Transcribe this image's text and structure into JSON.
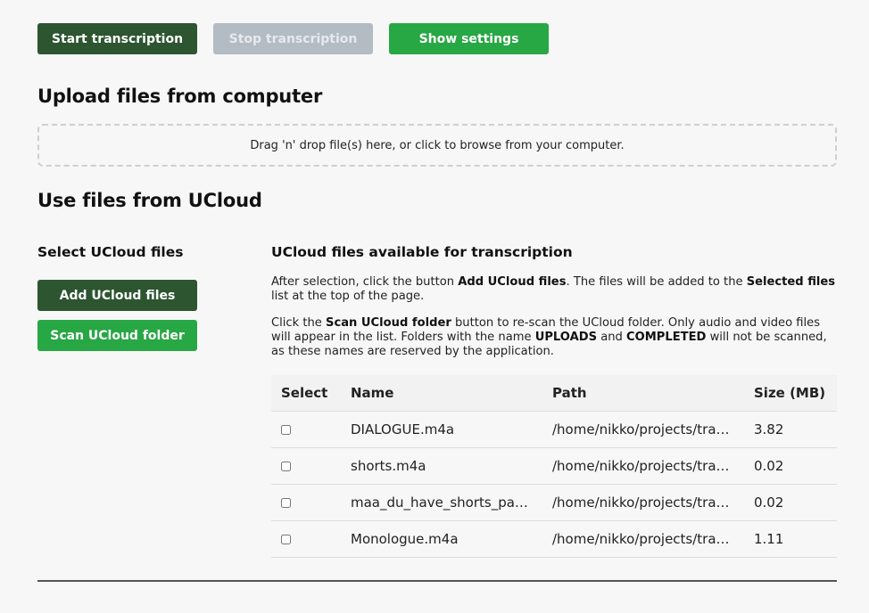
{
  "toolbar": {
    "start_label": "Start transcription",
    "stop_label": "Stop transcription",
    "settings_label": "Show settings"
  },
  "upload": {
    "heading": "Upload files from computer",
    "dropzone_text": "Drag 'n' drop file(s) here, or click to browse from your computer."
  },
  "ucloud": {
    "heading": "Use files from UCloud",
    "select_heading": "Select UCloud files",
    "add_label": "Add UCloud files",
    "scan_label": "Scan UCloud folder",
    "available_heading": "UCloud files available for transcription",
    "para1": {
      "t1": "After selection, click the button ",
      "b1": "Add UCloud files",
      "t2": ". The files will be added to the ",
      "b2": "Selected files",
      "t3": " list at the top of the page."
    },
    "para2": {
      "t1": "Click the ",
      "b1": "Scan UCloud folder",
      "t2": " button to re-scan the UCloud folder. Only audio and video files will appear in the list. Folders with the name ",
      "b2": "UPLOADS",
      "t3": " and ",
      "b3": "COMPLETED",
      "t4": " will not be scanned, as these names are reserved by the application."
    }
  },
  "table": {
    "headers": {
      "select": "Select",
      "name": "Name",
      "path": "Path",
      "size": "Size (MB)"
    },
    "rows": [
      {
        "name": "DIALOGUE.m4a",
        "path": "/home/nikko/projects/tra…",
        "size": "3.82",
        "checked": false
      },
      {
        "name": "shorts.m4a",
        "path": "/home/nikko/projects/tra…",
        "size": "0.02",
        "checked": false
      },
      {
        "name": "maa_du_have_shorts_paa…",
        "path": "/home/nikko/projects/tra…",
        "size": "0.02",
        "checked": false
      },
      {
        "name": "Monologue.m4a",
        "path": "/home/nikko/projects/tra…",
        "size": "1.11",
        "checked": false
      }
    ]
  },
  "colors": {
    "dark_green": "#2c5530",
    "green": "#28a745",
    "disabled": "#b3bcc3"
  }
}
